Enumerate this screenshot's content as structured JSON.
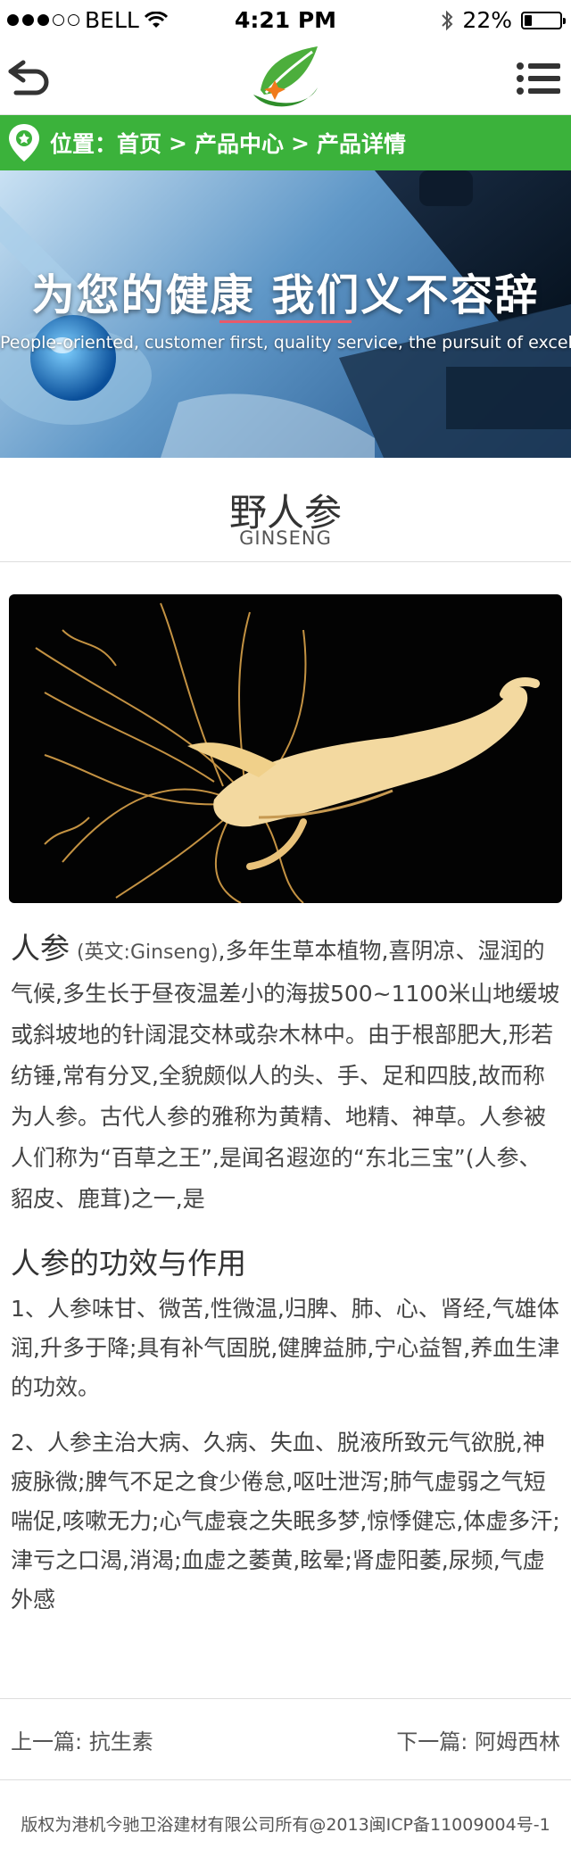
{
  "status_bar": {
    "carrier": "BELL",
    "time": "4:21 PM",
    "battery": "22%",
    "battery_level": 0.22
  },
  "header": {
    "back_icon": "back-arrow-icon",
    "logo_icon": "leaf-logo-icon",
    "menu_icon": "list-menu-icon"
  },
  "breadcrumb": {
    "icon": "location-pin-icon",
    "label": "位置：",
    "items": [
      "首页",
      "产品中心",
      "产品详情"
    ],
    "separator": ">"
  },
  "banner": {
    "title": "为您的健康  我们义不容辞",
    "subtitle": "People-oriented, customer first, quality service, the pursuit of excellence"
  },
  "product": {
    "name_cn": "野人参",
    "name_en": "GINSENG"
  },
  "article": {
    "intro_lead": "人参",
    "intro_en": "(英文:Ginseng)",
    "intro_body": ",多年生草本植物,喜阴凉、湿润的气候,多生长于昼夜温差小的海拔500~1100米山地缓坡或斜坡地的针阔混交林或杂木林中。由于根部肥大,形若纺锤,常有分叉,全貌颇似人的头、手、足和四肢,故而称为人参。古代人参的雅称为黄精、地精、神草。人参被人们称为“百草之王”,是闻名遐迩的“东北三宝”(人参、貂皮、鹿茸)之一,是",
    "section_title": "人参的功效与作用",
    "paragraphs": [
      "1、人参味甘、微苦,性微温,归脾、肺、心、肾经,气雄体润,升多于降;具有补气固脱,健脾益肺,宁心益智,养血生津的功效。",
      "2、人参主治大病、久病、失血、脱液所致元气欲脱,神疲脉微;脾气不足之食少倦怠,呕吐泄泻;肺气虚弱之气短喘促,咳嗽无力;心气虚衰之失眠多梦,惊悸健忘,体虚多汗;津亏之口渴,消渴;血虚之萎黄,眩晕;肾虚阳萎,尿频,气虚外感"
    ]
  },
  "pager": {
    "prev_label": "上一篇:",
    "prev_title": "抗生素",
    "next_label": "下一篇:",
    "next_title": "阿姆西林"
  },
  "footer": {
    "copyright": "版权为港机今驰卫浴建材有限公司所有@2013闽ICP备11009004号-1"
  },
  "colors": {
    "brand_green": "#3bb23b",
    "accent_red": "#e85a6a"
  }
}
